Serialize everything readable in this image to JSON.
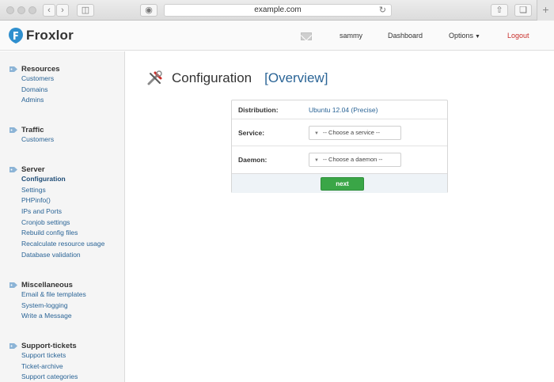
{
  "browser": {
    "url": "example.com"
  },
  "app": {
    "name": "Froxlor"
  },
  "header": {
    "username": "sammy",
    "dashboard": "Dashboard",
    "options": "Options",
    "logout": "Logout"
  },
  "sidebar": {
    "sections": [
      {
        "title": "Resources",
        "items": [
          "Customers",
          "Domains",
          "Admins"
        ]
      },
      {
        "title": "Traffic",
        "items": [
          "Customers"
        ]
      },
      {
        "title": "Server",
        "items": [
          "Configuration",
          "Settings",
          "PHPinfo()",
          "IPs and Ports",
          "Cronjob settings",
          "Rebuild config files",
          "Recalculate resource usage",
          "Database validation"
        ]
      },
      {
        "title": "Miscellaneous",
        "items": [
          "Email & file templates",
          "System-logging",
          "Write a Message"
        ]
      },
      {
        "title": "Support-tickets",
        "items": [
          "Support tickets",
          "Ticket-archive",
          "Support categories"
        ]
      }
    ],
    "active_item": "Configuration"
  },
  "main": {
    "title": "Configuration",
    "title_link": "[Overview]",
    "form": {
      "distribution_label": "Distribution:",
      "distribution_value": "Ubuntu 12.04 (Precise)",
      "service_label": "Service:",
      "service_placeholder": "-- Choose a service --",
      "daemon_label": "Daemon:",
      "daemon_placeholder": "-- Choose a daemon --",
      "next_button": "next"
    }
  },
  "colors": {
    "link": "#2a6496",
    "logout": "#c9302c",
    "next_button": "#3aa647",
    "logo_blue": "#2f8fce"
  },
  "icons": {
    "logo": "froxlor-logo-icon",
    "mail": "mail-icon",
    "section": "tag-icon",
    "title": "tools-icon"
  }
}
